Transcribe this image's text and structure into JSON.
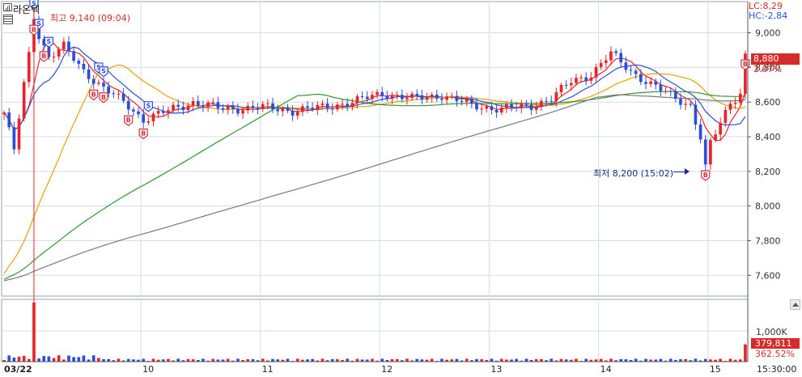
{
  "stock": {
    "name": "라온텍",
    "lc_text": "LC:8,29",
    "hc_text": "HC:-2,84",
    "current_price": "8,880",
    "change_pct": "2.07%",
    "high_note": "최고 9,140 (09:04)",
    "low_note": "최저 8,200 (15:02)"
  },
  "volume_panel": {
    "axis_label": "1,000K",
    "current_volume": "379,811",
    "volume_ratio": "362.52%"
  },
  "colors": {
    "up": "#e8232b",
    "down": "#2a4fd6",
    "ma5": "#e8232b",
    "ma10": "#2a4fd6",
    "ma20": "#e6a100",
    "ma60": "#2e9a2e",
    "ma120": "#7a7a7a",
    "grid": "#d7dbe3",
    "price_tag_bg": "#d52b2b",
    "buy_marker": "#d0303a",
    "sell_marker": "#2a4fd6"
  },
  "chart_data": {
    "type": "candlestick",
    "interval": "intraday, multiple sessions",
    "y_axis": {
      "ticks": [
        7600,
        7800,
        8000,
        8200,
        8400,
        8600,
        8800,
        9000
      ],
      "tick_labels": [
        "7,600",
        "7,800",
        "8,000",
        "8,200",
        "8,400",
        "8,600",
        "8,800",
        "9,000"
      ],
      "ylim": [
        7480,
        9180
      ],
      "position": "right"
    },
    "x_axis": {
      "labels": [
        "03/22",
        "10",
        "11",
        "12",
        "13",
        "14",
        "15",
        "15:30:00"
      ]
    },
    "grid": true,
    "high": {
      "value": 9140,
      "time": "09:04"
    },
    "low": {
      "value": 8200,
      "time": "15:02"
    },
    "last": 8880,
    "anchors": [
      {
        "x": 0,
        "p": 8540
      },
      {
        "x": 2,
        "p": 8320
      },
      {
        "x": 4,
        "p": 8700
      },
      {
        "x": 6,
        "p": 9050
      },
      {
        "x": 9,
        "p": 8860
      },
      {
        "x": 12,
        "p": 8920
      },
      {
        "x": 16,
        "p": 8780
      },
      {
        "x": 20,
        "p": 8680
      },
      {
        "x": 24,
        "p": 8600
      },
      {
        "x": 28,
        "p": 8500
      },
      {
        "x": 33,
        "p": 8550
      },
      {
        "x": 38,
        "p": 8600
      },
      {
        "x": 44,
        "p": 8560
      },
      {
        "x": 52,
        "p": 8570
      },
      {
        "x": 58,
        "p": 8550
      },
      {
        "x": 64,
        "p": 8570
      },
      {
        "x": 70,
        "p": 8600
      },
      {
        "x": 76,
        "p": 8650
      },
      {
        "x": 82,
        "p": 8620
      },
      {
        "x": 88,
        "p": 8640
      },
      {
        "x": 94,
        "p": 8580
      },
      {
        "x": 100,
        "p": 8560
      },
      {
        "x": 106,
        "p": 8580
      },
      {
        "x": 110,
        "p": 8620
      },
      {
        "x": 114,
        "p": 8720
      },
      {
        "x": 118,
        "p": 8760
      },
      {
        "x": 122,
        "p": 8880
      },
      {
        "x": 126,
        "p": 8780
      },
      {
        "x": 130,
        "p": 8700
      },
      {
        "x": 134,
        "p": 8640
      },
      {
        "x": 138,
        "p": 8580
      },
      {
        "x": 141,
        "p": 8300
      },
      {
        "x": 143,
        "p": 8420
      },
      {
        "x": 146,
        "p": 8600
      },
      {
        "x": 149,
        "p": 8680
      }
    ],
    "day_boundaries": [
      28,
      52,
      76,
      98,
      120,
      142
    ],
    "volume": {
      "spike_index": 6,
      "spike_value": 1300,
      "base_value": 40,
      "last_value": 380,
      "unit": "K"
    },
    "moving_averages": [
      {
        "name": "MA5",
        "color_key": "ma5",
        "window": 5
      },
      {
        "name": "MA10",
        "color_key": "ma10",
        "window": 10
      },
      {
        "name": "MA20",
        "color_key": "ma20",
        "window": 20
      },
      {
        "name": "MA60",
        "color_key": "ma60",
        "window": 60
      },
      {
        "name": "MA120",
        "color_key": "ma120",
        "window": 120
      }
    ],
    "signals": [
      {
        "type": "S",
        "x": 6
      },
      {
        "type": "S",
        "x": 7
      },
      {
        "type": "S",
        "x": 9
      },
      {
        "type": "S",
        "x": 19
      },
      {
        "type": "S",
        "x": 20
      },
      {
        "type": "S",
        "x": 29
      },
      {
        "type": "B",
        "x": 6
      },
      {
        "type": "B",
        "x": 8
      },
      {
        "type": "B",
        "x": 18
      },
      {
        "type": "B",
        "x": 20
      },
      {
        "type": "B",
        "x": 25
      },
      {
        "type": "B",
        "x": 28
      },
      {
        "type": "B",
        "x": 141
      },
      {
        "type": "B",
        "x": 149
      }
    ]
  }
}
